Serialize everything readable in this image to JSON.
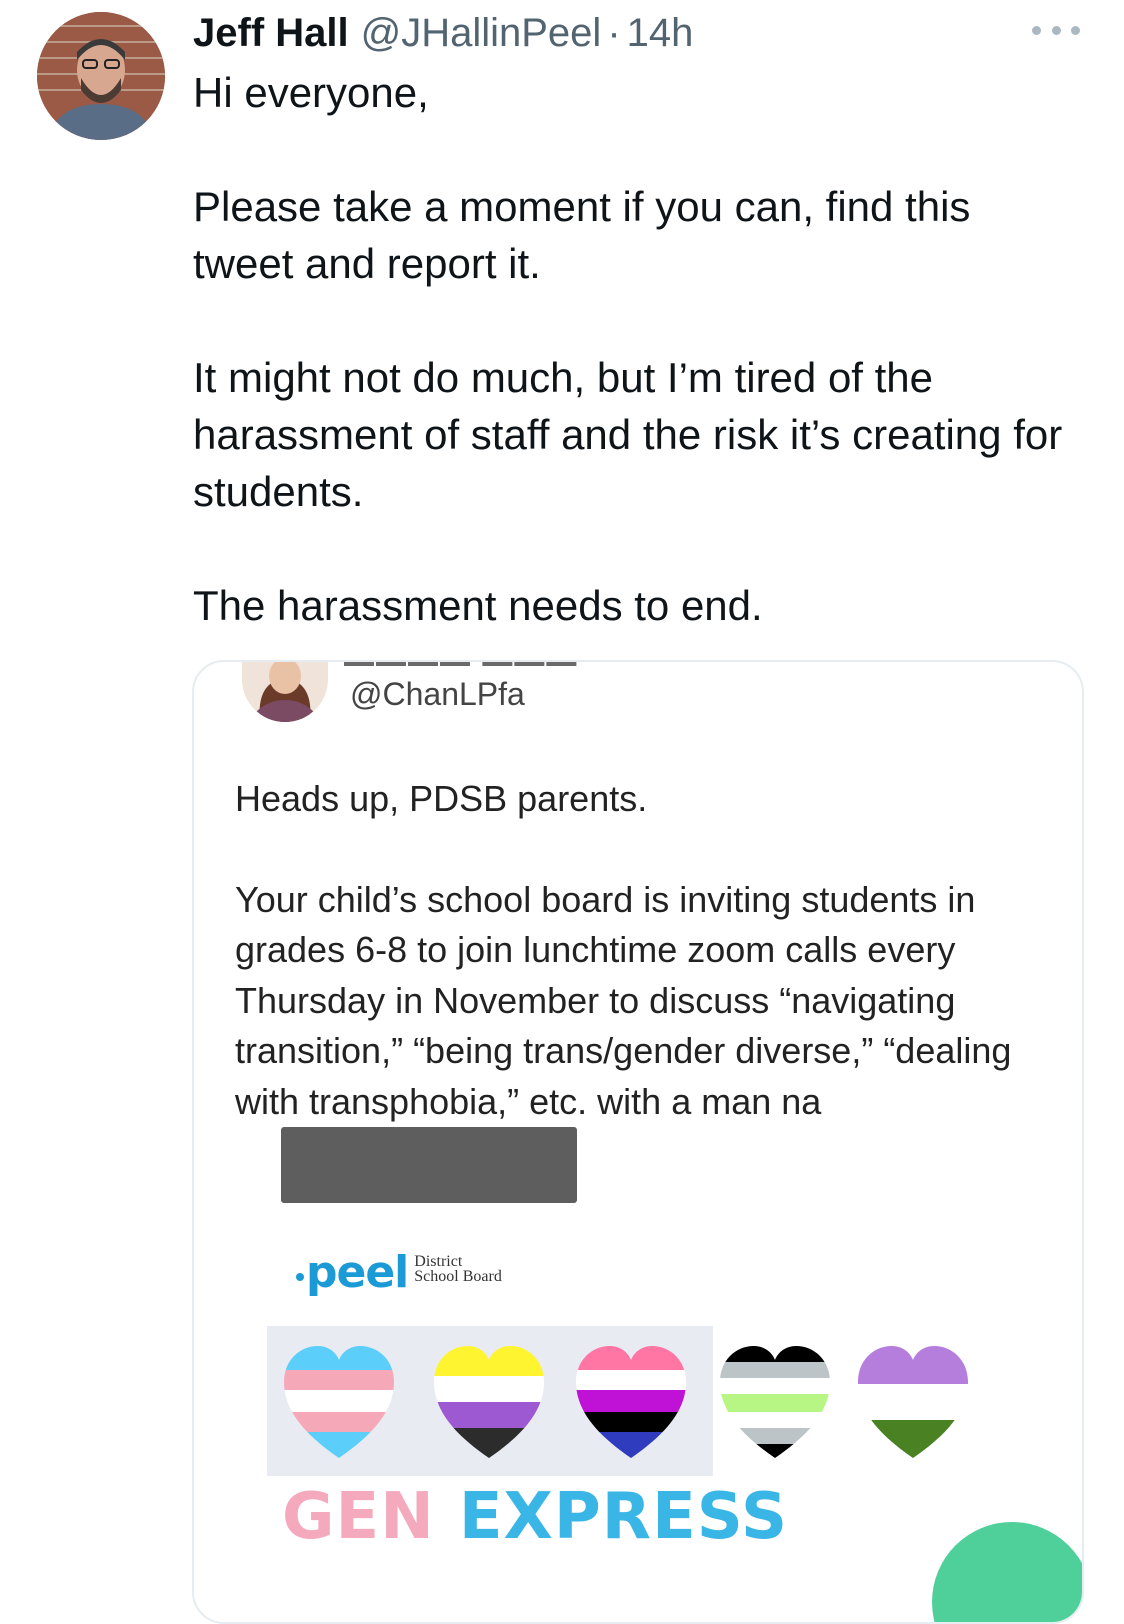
{
  "tweet": {
    "author_name": "Jeff Hall",
    "author_handle": "@JHallinPeel",
    "separator": "·",
    "time": "14h",
    "paragraphs": [
      "Hi everyone,",
      "Please take a moment if you can, find this tweet and report it.",
      "It might not do much, but I’m tired of the harassment of staff and the risk it’s creating for students.",
      "The harassment needs to end."
    ]
  },
  "quoted": {
    "handle": "@ChanLPfa",
    "paragraphs": [
      "Heads up, PDSB parents.",
      "Your child’s school board is inviting students in grades 6-8 to join lunchtime zoom calls every Thursday in November to discuss “navigating transition,” “being trans/gender diverse,” “dealing with transphobia,” etc. with a man na"
    ],
    "image": {
      "logo_word": "peel",
      "logo_sub_1": "District",
      "logo_sub_2": "School Board",
      "banner_word_1": "GEN",
      "banner_word_2": "EXPRESS",
      "hearts": [
        "trans-flag-heart",
        "nonbinary-flag-heart",
        "genderfluid-flag-heart",
        "agender-flag-heart",
        "genderqueer-flag-heart"
      ]
    }
  },
  "colors": {
    "text": "#0f1419",
    "secondary": "#536471",
    "peel_blue": "#1c9ad6",
    "gen_pink": "#f4a9bd",
    "express_blue": "#3ab6e6"
  }
}
